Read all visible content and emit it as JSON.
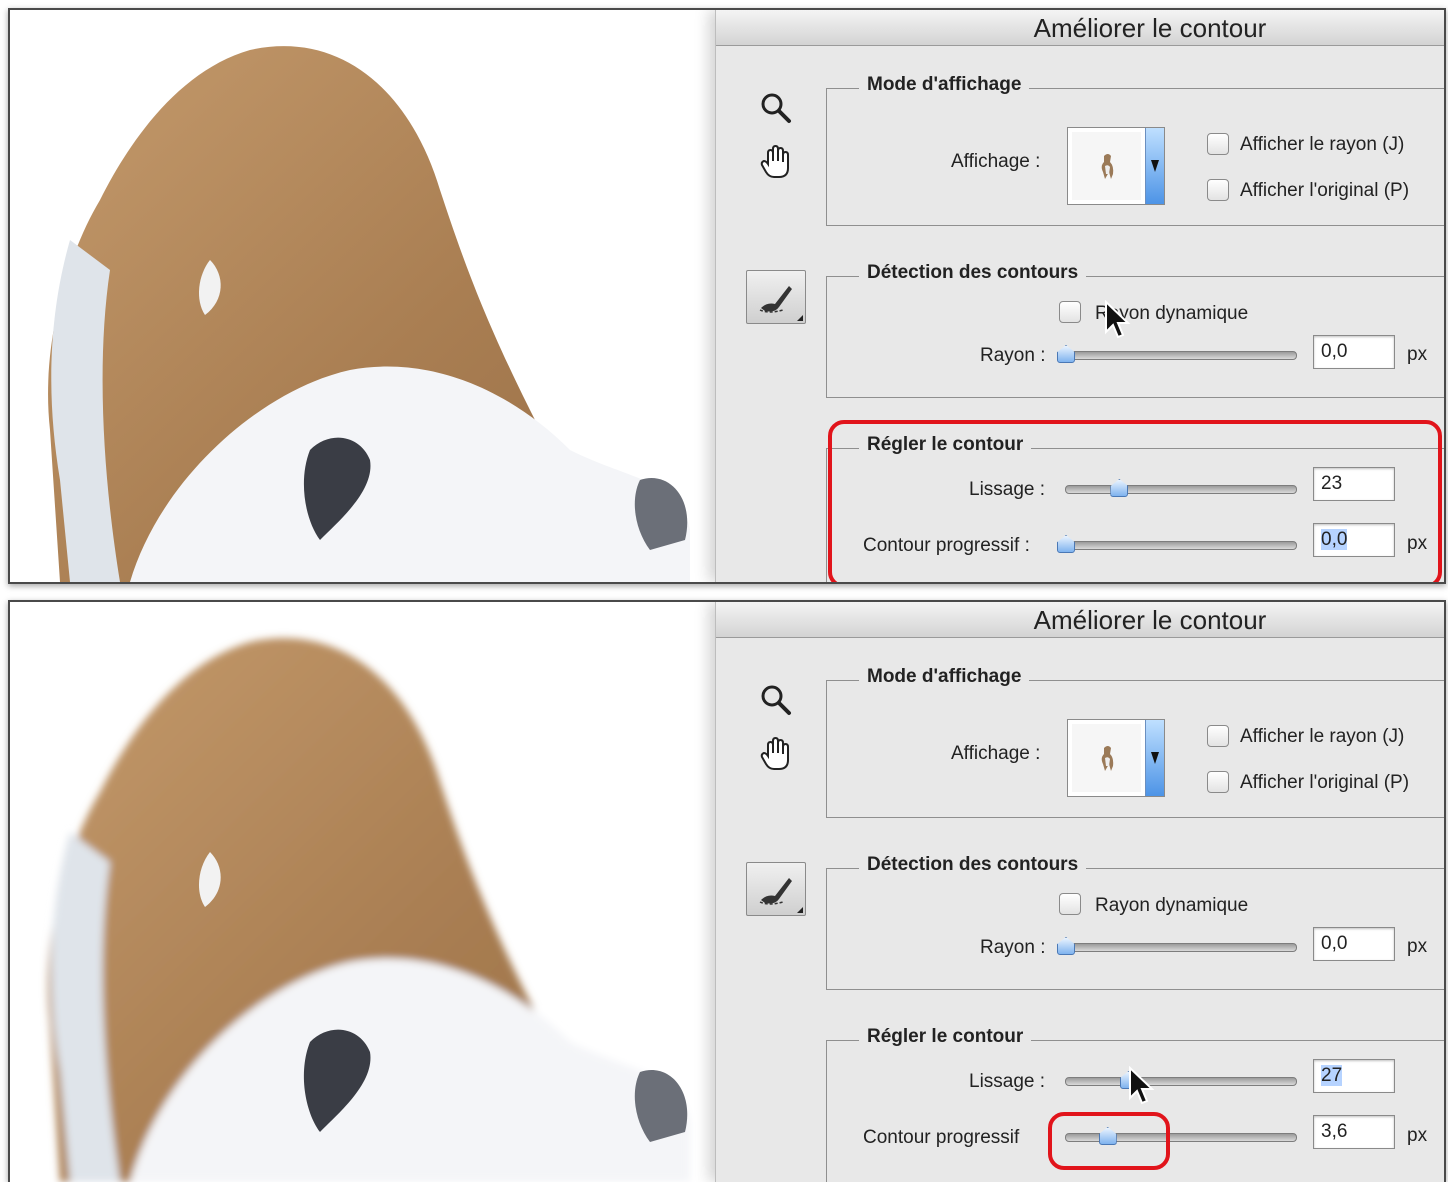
{
  "panels": [
    {
      "title": "Améliorer le contour",
      "display_mode": {
        "legend": "Mode d'affichage",
        "display_label": "Affichage :",
        "show_radius_label": "Afficher le rayon (J)",
        "show_original_label": "Afficher l'original (P)",
        "show_radius_checked": false,
        "show_original_checked": false
      },
      "edge_detection": {
        "legend": "Détection des contours",
        "smart_radius_label": "Rayon dynamique",
        "smart_radius_checked": false,
        "radius_label": "Rayon :",
        "radius_value": "0,0",
        "radius_unit": "px",
        "radius_slider_fraction": 0.0
      },
      "adjust_edge": {
        "legend": "Régler le contour",
        "smooth_label": "Lissage :",
        "smooth_value": "23",
        "smooth_slider_fraction": 0.23,
        "feather_label": "Contour progressif :",
        "feather_value": "0,0",
        "feather_unit": "px",
        "feather_slider_fraction": 0.0
      }
    },
    {
      "title": "Améliorer le contour",
      "display_mode": {
        "legend": "Mode d'affichage",
        "display_label": "Affichage :",
        "show_radius_label": "Afficher le rayon (J)",
        "show_original_label": "Afficher l'original (P)",
        "show_radius_checked": false,
        "show_original_checked": false
      },
      "edge_detection": {
        "legend": "Détection des contours",
        "smart_radius_label": "Rayon dynamique",
        "smart_radius_checked": false,
        "radius_label": "Rayon :",
        "radius_value": "0,0",
        "radius_unit": "px",
        "radius_slider_fraction": 0.0
      },
      "adjust_edge": {
        "legend": "Régler le contour",
        "smooth_label": "Lissage :",
        "smooth_value": "27",
        "smooth_slider_fraction": 0.27,
        "feather_label": "Contour progressif",
        "feather_value": "3,6",
        "feather_unit": "px",
        "feather_slider_fraction": 0.18
      }
    }
  ],
  "colors": {
    "highlight": "#e1141b",
    "panel_bg": "#e8e8e8",
    "dog_brown": "#b58a5c",
    "dog_white": "#f4f5f8"
  },
  "icons": [
    "zoom-icon",
    "hand-icon",
    "refine-radius-brush-icon",
    "mouse-cursor-icon"
  ]
}
